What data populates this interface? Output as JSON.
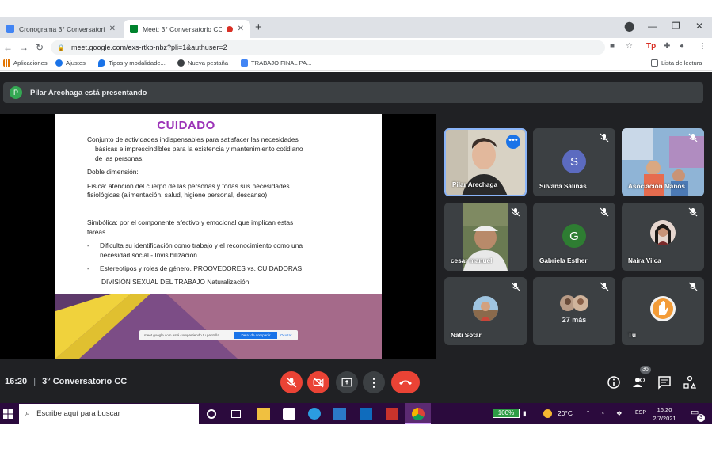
{
  "browser": {
    "tabs": [
      {
        "title": "Cronograma 3° Conversatorio CC",
        "icon": "docs-icon",
        "active": false
      },
      {
        "title": "Meet: 3° Conversatorio CC",
        "icon": "meet-icon",
        "active": true
      }
    ],
    "url": "meet.google.com/exs-rtkb-nbz?pli=1&authuser=2",
    "bookmarks": [
      {
        "label": "Aplicaciones",
        "icon": "apps-grid-icon"
      },
      {
        "label": "Ajustes",
        "icon": "gear-icon"
      },
      {
        "label": "Tipos y modalidade...",
        "icon": "drop-icon"
      },
      {
        "label": "Nueva pestaña",
        "icon": "globe-icon"
      },
      {
        "label": "TRABAJO FINAL PA...",
        "icon": "docs-icon"
      }
    ],
    "reading_list": "Lista de lectura"
  },
  "meet": {
    "presenter_initial": "P",
    "presenting_banner": "Pilar Arechaga está presentando",
    "slide": {
      "title": "CUIDADO",
      "lines": [
        "Conjunto de actividades indispensables para satisfacer las necesidades",
        "básicas e imprescindibles para la existencia y mantenimiento cotidiano",
        "de las personas.",
        "Doble dimensión:",
        "Física: atención del cuerpo de las personas y todas sus necesidades",
        "fisiológicas (alimentación, salud, higiene personal, descanso)",
        "Simbólica: por el componente afectivo y emocional que implican estas",
        "tareas.",
        "Dificulta su identificación como trabajo y el reconocimiento como una",
        "necesidad social - Invisibilización",
        "Estereotipos y roles de género. PROOVEDORES vs. CUIDADORAS",
        "DIVISIÓN SEXUAL DEL TRABAJO Naturalización"
      ],
      "bullet": "-",
      "share_notice": "meet.google.com está compartiendo tu pantalla.",
      "share_stop": "Dejar de compartir",
      "share_hide": "Ocultar"
    },
    "participants": [
      {
        "name": "Pilar Arechaga",
        "type": "video",
        "muted": false,
        "more": "•••"
      },
      {
        "name": "Silvana Salinas",
        "type": "letter",
        "letter": "S",
        "color": "#5c6bc0",
        "muted": true
      },
      {
        "name": "Asociación Manos",
        "type": "video",
        "muted": true
      },
      {
        "name": "cesar manuel",
        "type": "video",
        "muted": true
      },
      {
        "name": "Gabriela Esther",
        "type": "letter",
        "letter": "G",
        "color": "#2e7d32",
        "muted": true
      },
      {
        "name": "Naira Vilca",
        "type": "photo",
        "muted": false
      },
      {
        "name": "Nati Sotar",
        "type": "photo",
        "muted": true
      },
      {
        "name": "27 más",
        "type": "group",
        "muted": true
      },
      {
        "name": "Tú",
        "type": "photo",
        "muted": true
      }
    ],
    "time": "16:20",
    "meeting_title": "3° Conversatorio CC",
    "separator": "|",
    "people_count": "36"
  },
  "taskbar": {
    "search_placeholder": "Escribe aquí para buscar",
    "battery": "100%",
    "temperature": "20°C",
    "language": "ESP",
    "clock_time": "16:20",
    "clock_date": "2/7/2021",
    "notification_count": "3"
  },
  "colors": {
    "meet_bg": "#202124",
    "tile_bg": "#3c4043",
    "danger": "#ea4335",
    "accent": "#1a73e8",
    "slide_title": "#9b32b7",
    "taskbar_bg": "#2b0a3d"
  }
}
